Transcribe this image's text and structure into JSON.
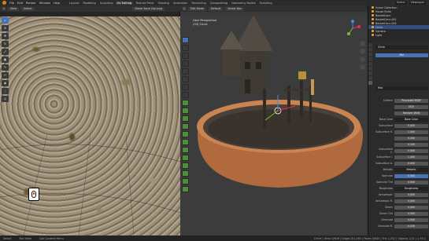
{
  "menu": [
    "File",
    "Edit",
    "Render",
    "Window",
    "Help"
  ],
  "workspaces": [
    "Layout",
    "Modeling",
    "Sculpting",
    "UV Editing",
    "Texture Paint",
    "Shading",
    "Animation",
    "Rendering",
    "Compositing",
    "Geometry Nodes",
    "Scripting"
  ],
  "active_workspace_index": 3,
  "scene_name": "Scene",
  "view_layer": "ViewLayer",
  "image_editor": {
    "mode": "View",
    "select_menu": "Select",
    "image_name": "Stone Sand Con.png",
    "tools": [
      "select",
      "cursor",
      "move",
      "rotate",
      "scale",
      "transform",
      "annotate",
      "rip",
      "grab",
      "relax",
      "pinch"
    ]
  },
  "viewport": {
    "mode": "Edit Mode",
    "orientation": "Default",
    "select_menu": "Select Box",
    "view_label": "User Perspective",
    "object_label": "(33) Circle"
  },
  "outliner": {
    "items": [
      "Scene Collection",
      "House Build",
      "BasketConc",
      "BasketConc.001",
      "BasketConc.002",
      "Circle",
      "Camera",
      "Light"
    ],
    "selected_index": 5
  },
  "properties": {
    "object": "Circle",
    "material_tab": "Mat",
    "material_name": "Mat",
    "surface": "Principled BSDF",
    "distribution": "GGX",
    "subsurface_method": "Random Walk",
    "rows": [
      {
        "label": "Surface",
        "value": "Principled BSDF"
      },
      {
        "label": "",
        "value": "GGX"
      },
      {
        "label": "",
        "value": "Random Walk"
      },
      {
        "label": "Base Color",
        "value": "Base Color"
      },
      {
        "label": "Subsurface",
        "value": "0.000"
      },
      {
        "label": "Subsurface R.",
        "value": "1.000"
      },
      {
        "label": "",
        "value": "0.200"
      },
      {
        "label": "",
        "value": "0.100"
      },
      {
        "label": "Subsurface C.",
        "value": "0.000"
      },
      {
        "label": "Subsurface I.",
        "value": "1.400"
      },
      {
        "label": "Subsurface A.",
        "value": "0.000"
      },
      {
        "label": "Metallic",
        "value": "Metallic"
      },
      {
        "label": "Specular",
        "value": "0.500"
      },
      {
        "label": "Specular Tint",
        "value": "0.000"
      },
      {
        "label": "Roughness",
        "value": "Roughness"
      },
      {
        "label": "Anisotropic",
        "value": "0.000"
      },
      {
        "label": "Anisotropic R.",
        "value": "0.000"
      },
      {
        "label": "Sheen",
        "value": "0.000"
      },
      {
        "label": "Sheen Tint",
        "value": "0.500"
      },
      {
        "label": "Clearcoat",
        "value": "0.000"
      },
      {
        "label": "Clearcoat R.",
        "value": "0.030"
      }
    ]
  },
  "status": {
    "left": [
      "Select",
      "Pan View",
      "Call Context Menu"
    ],
    "right": "Circle | Verts 0/628 | Edges 0/1,260 | Faces 0/630 | Tris 1,252 | Objects 1/21 | 2.93.1"
  },
  "colors": {
    "accent": "#4772b3",
    "orange": "#e87d0d",
    "x_axis": "#e03050",
    "y_axis": "#7fbf2f",
    "z_axis": "#4f88e0"
  }
}
